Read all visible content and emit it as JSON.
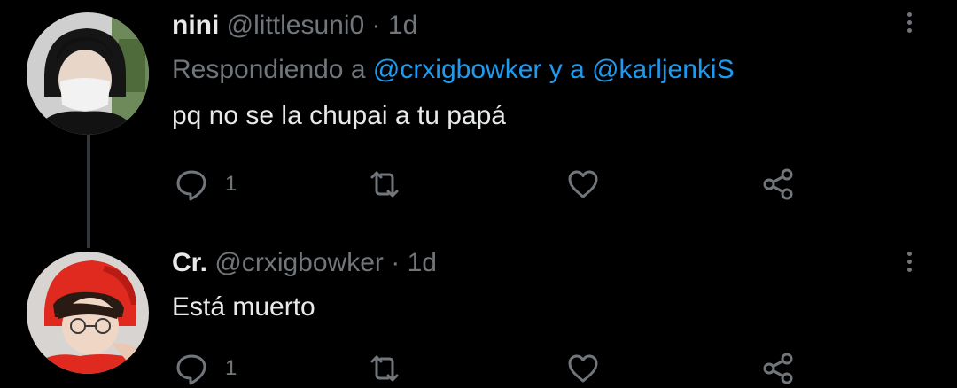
{
  "tweets": [
    {
      "name": "nini",
      "handle": "@littlesuni0",
      "separator": "·",
      "time": "1d",
      "replying_prefix": "Respondiendo a",
      "mention_1": "@crxigbowker",
      "mention_joiner": "y a",
      "mention_2": "@karljenkiS",
      "text": "pq no se la chupai a tu papá",
      "reply_count": "1"
    },
    {
      "name": "Cr.",
      "handle": "@crxigbowker",
      "separator": "·",
      "time": "1d",
      "text": "Está muerto",
      "reply_count": "1"
    }
  ],
  "icons": {
    "reply": "reply-icon",
    "retweet": "retweet-icon",
    "like": "heart-icon",
    "share": "share-icon",
    "more": "more-vertical-icon"
  },
  "colors": {
    "background": "#000000",
    "primary_text": "#e7e9ea",
    "secondary_text": "#71767b",
    "link": "#1d9bf0",
    "thread_line": "#333639"
  }
}
